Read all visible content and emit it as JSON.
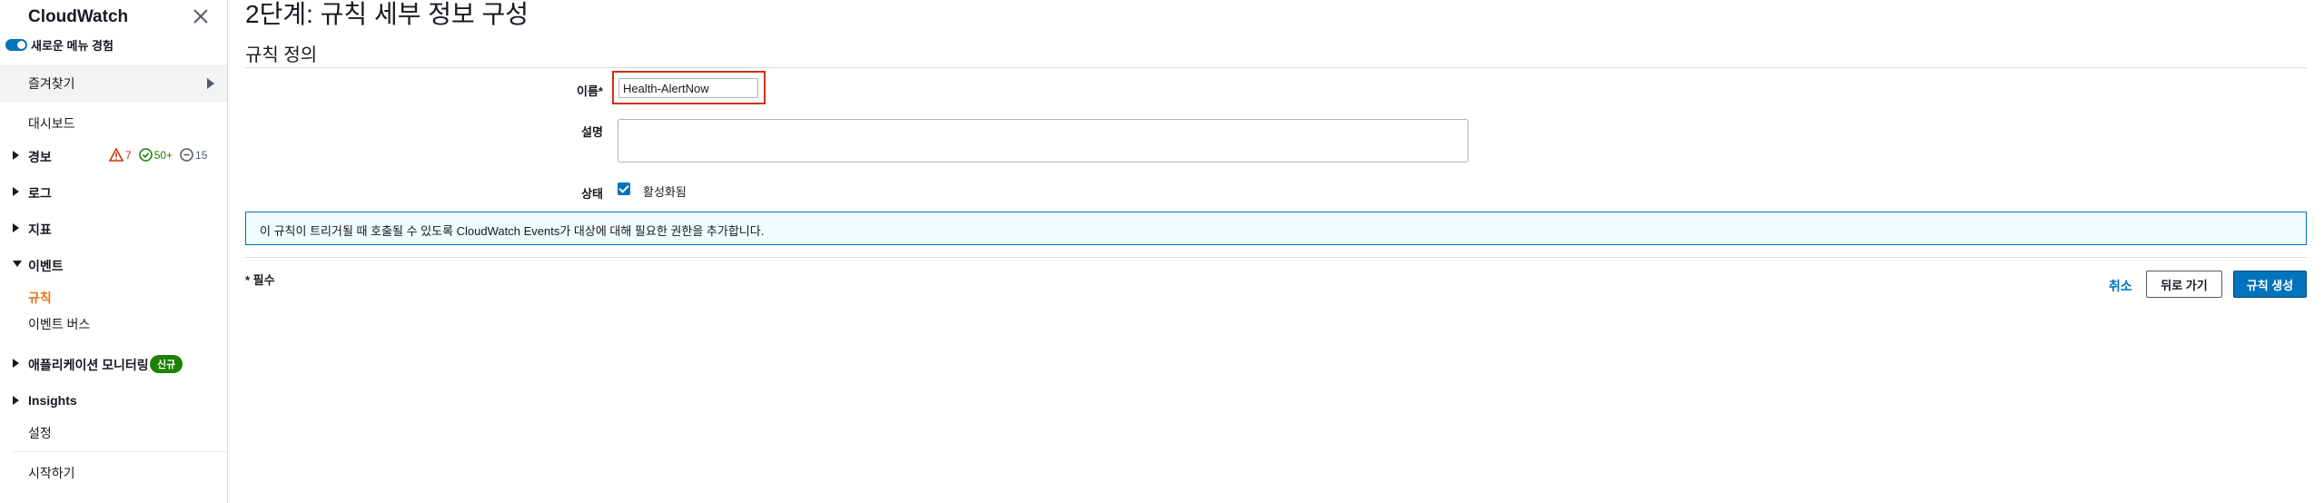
{
  "sidebar": {
    "title": "CloudWatch",
    "toggle_label": "새로운 메뉴 경험",
    "favorites_label": "즐겨찾기",
    "dashboard_label": "대시보드",
    "alarms": {
      "label": "경보",
      "alarm_count": "7",
      "ok_count": "50+",
      "insufficient_count": "15"
    },
    "logs_label": "로그",
    "metrics_label": "지표",
    "events": {
      "label": "이벤트",
      "rules_label": "규칙",
      "event_bus_label": "이벤트 버스"
    },
    "app_monitoring": {
      "label": "애플리케이션 모니터링",
      "badge": "신규"
    },
    "insights_label": "Insights",
    "settings_label": "설정",
    "getting_started_label": "시작하기"
  },
  "main": {
    "page_title": "2단계: 규칙 세부 정보 구성",
    "section_title": "규칙 정의",
    "form": {
      "name_label": "이름*",
      "name_value": "Health-AlertNow",
      "description_label": "설명",
      "description_value": "",
      "state_label": "상태",
      "enabled_label": "활성화됨",
      "enabled_checked": true
    },
    "info_text": "이 규칙이 트리거될 때 호출될 수 있도록 CloudWatch Events가 대상에 대해 필요한 권한을 추가합니다.",
    "required_note": "* 필수",
    "buttons": {
      "cancel": "취소",
      "back": "뒤로 가기",
      "create": "규칙 생성"
    }
  },
  "colors": {
    "accent": "#0073bb",
    "active_nav": "#ec7211",
    "alarm_red": "#d13212",
    "ok_green": "#1d8102",
    "highlight_border": "#d13212"
  }
}
